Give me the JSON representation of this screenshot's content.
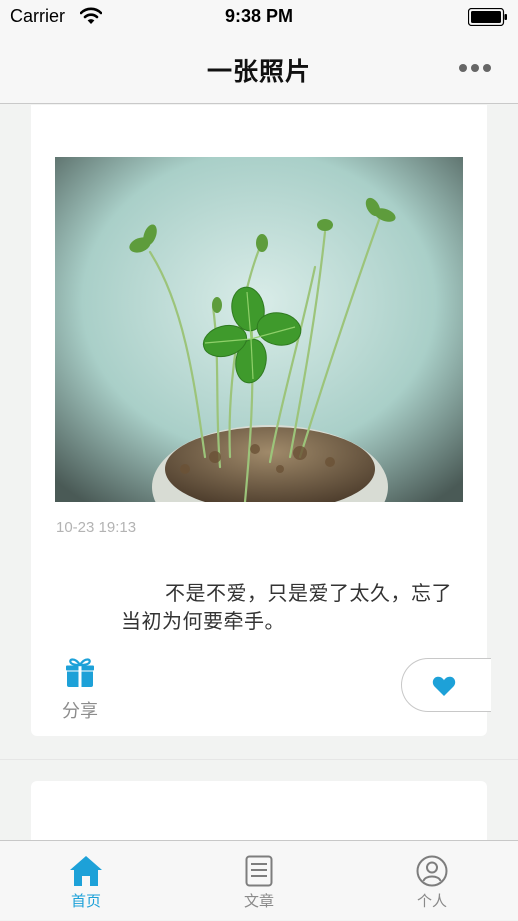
{
  "status_bar": {
    "carrier": "Carrier",
    "time": "9:38 PM",
    "wifi_icon": "wifi-icon",
    "battery_icon": "battery-icon"
  },
  "nav": {
    "title": "一张照片",
    "more_icon": "more-icon"
  },
  "card": {
    "photo_subject": "four-leaf clover sprouts in a pot",
    "date": "10-23 19:13",
    "quote": "不是不爱，只是爱了太久，忘了当初为何要牵手。",
    "share_label": "分享",
    "share_icon": "gift-icon",
    "like_icon": "heart-icon"
  },
  "tabs": [
    {
      "label": "首页",
      "icon": "home-icon",
      "active": true
    },
    {
      "label": "文章",
      "icon": "article-icon",
      "active": false
    },
    {
      "label": "个人",
      "icon": "user-icon",
      "active": false
    }
  ],
  "colors": {
    "accent": "#1da1d8",
    "background": "#f2f3f2",
    "card": "#ffffff",
    "bar": "#f7f7f7"
  }
}
